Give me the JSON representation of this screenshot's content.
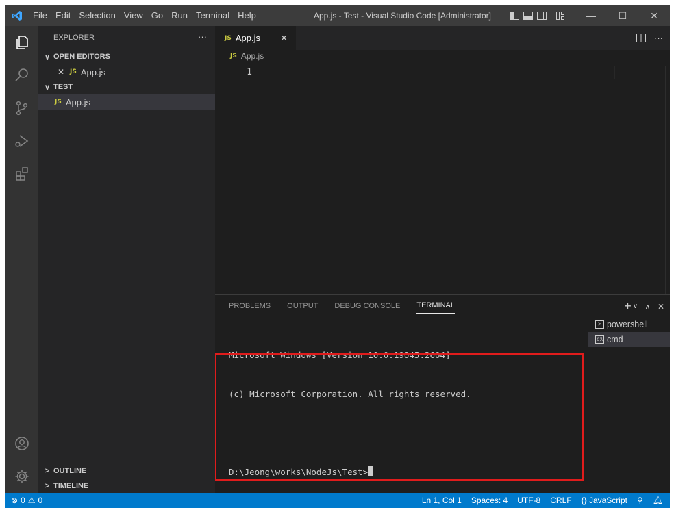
{
  "titlebar": {
    "menus": [
      "File",
      "Edit",
      "Selection",
      "View",
      "Go",
      "Run",
      "Terminal",
      "Help"
    ],
    "title": "App.js - Test - Visual Studio Code [Administrator]",
    "minimize": "—",
    "maximize": "☐",
    "close": "✕"
  },
  "sidebar": {
    "header": "EXPLORER",
    "more": "···",
    "open_editors": "OPEN EDITORS",
    "open_editor_file": "App.js",
    "folder": "TEST",
    "file": "App.js",
    "outline": "OUTLINE",
    "timeline": "TIMELINE",
    "js_badge": "JS"
  },
  "editor": {
    "tab_label": "App.js",
    "tab_close": "✕",
    "breadcrumb": "App.js",
    "line_number": "1"
  },
  "panel": {
    "tabs": [
      "PROBLEMS",
      "OUTPUT",
      "DEBUG CONSOLE",
      "TERMINAL"
    ],
    "active_tab": "TERMINAL",
    "terminal_lines": [
      "Microsoft Windows [Version 10.0.19045.2604]",
      "(c) Microsoft Corporation. All rights reserved."
    ],
    "prompt": "D:\\Jeong\\works\\NodeJs\\Test>",
    "terminals": [
      "powershell",
      "cmd"
    ],
    "active_terminal": "cmd"
  },
  "statusbar": {
    "errors": "0",
    "warnings": "0",
    "position": "Ln 1, Col 1",
    "spaces": "Spaces: 4",
    "encoding": "UTF-8",
    "eol": "CRLF",
    "language": "JavaScript",
    "language_icon": "{}"
  },
  "colors": {
    "status_bar": "#007acc",
    "highlight_box": "#e01c1c",
    "js_badge": "#cbcb41"
  }
}
